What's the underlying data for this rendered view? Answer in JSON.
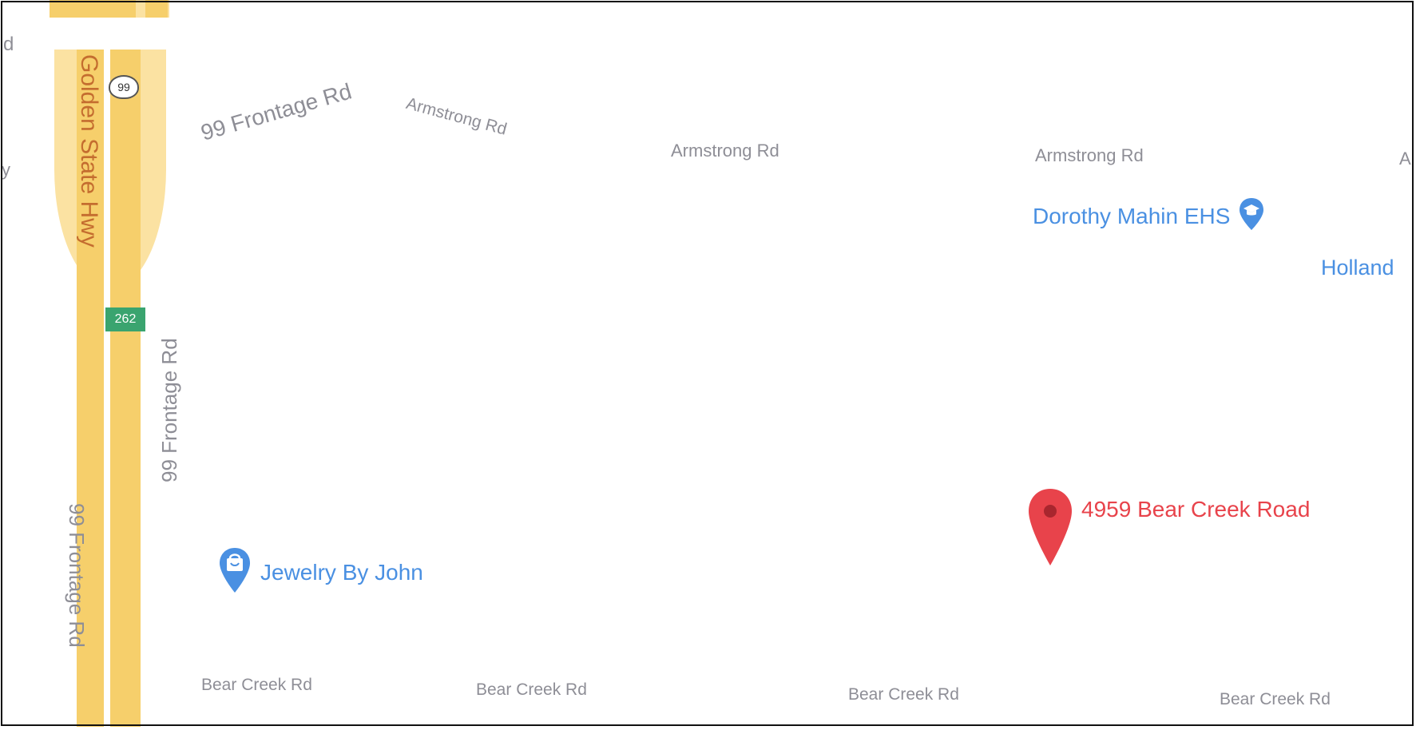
{
  "map": {
    "highway": {
      "name": "Golden State Hwy",
      "route_shield": "99",
      "exit_number": "262"
    },
    "road_labels": {
      "frontage_curved": "99 Frontage Rd",
      "frontage_east": "99 Frontage Rd",
      "frontage_west": "99 Frontage Rd",
      "armstrong_1": "Armstrong Rd",
      "armstrong_2": "Armstrong Rd",
      "armstrong_3": "Armstrong Rd",
      "bear_creek_1": "Bear Creek Rd",
      "bear_creek_2": "Bear Creek Rd",
      "bear_creek_3": "Bear Creek Rd",
      "bear_creek_4": "Bear Creek Rd",
      "edge_top_left": "d",
      "edge_left": "y",
      "edge_right": "A"
    },
    "pois": {
      "school": {
        "name": "Dorothy Mahin EHS",
        "icon": "graduation-cap-icon"
      },
      "shop": {
        "name": "Jewelry By John",
        "icon": "shopping-bag-icon"
      },
      "area": {
        "name": "Holland"
      },
      "destination": {
        "name": "4959 Bear Creek Road",
        "icon": "red-pin-icon"
      }
    },
    "colors": {
      "highway": "#f6cf6b",
      "poi_blue": "#4a90e2",
      "destination_red": "#e8434b",
      "road_label": "#8e8e96",
      "highway_label": "#c46d2f",
      "exit_sign": "#3aa46f"
    }
  }
}
